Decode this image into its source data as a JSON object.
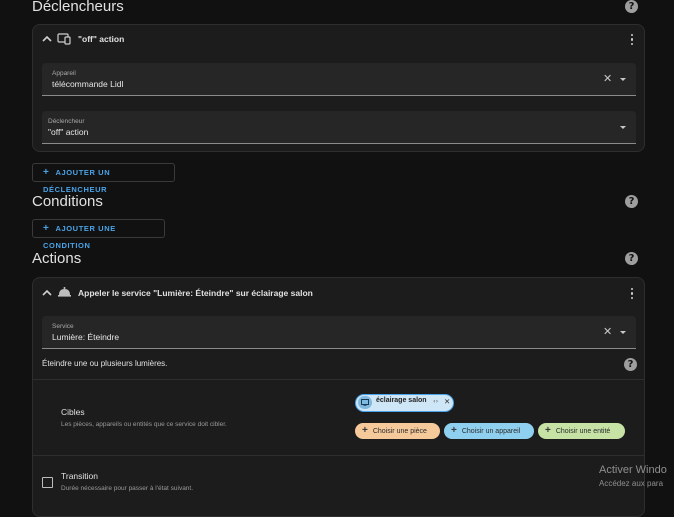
{
  "sections": {
    "triggers_title": "Déclencheurs",
    "conditions_title": "Conditions",
    "actions_title": "Actions"
  },
  "trigger_card": {
    "title": "\"off\" action",
    "device_field": {
      "label": "Appareil",
      "value": "télécommande Lidl"
    },
    "trigger_field": {
      "label": "Déclencheur",
      "value": "\"off\" action"
    }
  },
  "buttons": {
    "add_trigger": "AJOUTER UN DÉCLENCHEUR",
    "add_condition": "AJOUTER UNE CONDITION"
  },
  "action_card": {
    "title": "Appeler le service \"Lumière: Éteindre\" sur éclairage salon",
    "service_field": {
      "label": "Service",
      "value": "Lumière: Éteindre"
    },
    "description": "Éteindre une ou plusieurs lumières.",
    "targets": {
      "label": "Cibles",
      "hint": "Les pièces, appareils ou entités que ce service doit cibler.",
      "chip": "éclairage salon",
      "choose_room": "Choisir une pièce",
      "choose_device": "Choisir un appareil",
      "choose_entity": "Choisir une entité"
    },
    "transition": {
      "label": "Transition",
      "hint": "Durée nécessaire pour passer à l'état suivant."
    }
  },
  "watermark": {
    "line1": "Activer Windo",
    "line2": "Accédez aux para"
  },
  "colors": {
    "accent": "#4aa3e8",
    "room_pill": "#f5c99a",
    "device_pill": "#8fd0f0",
    "entity_pill": "#c6e3a5",
    "background": "#111111",
    "card": "#1c1c1c"
  }
}
